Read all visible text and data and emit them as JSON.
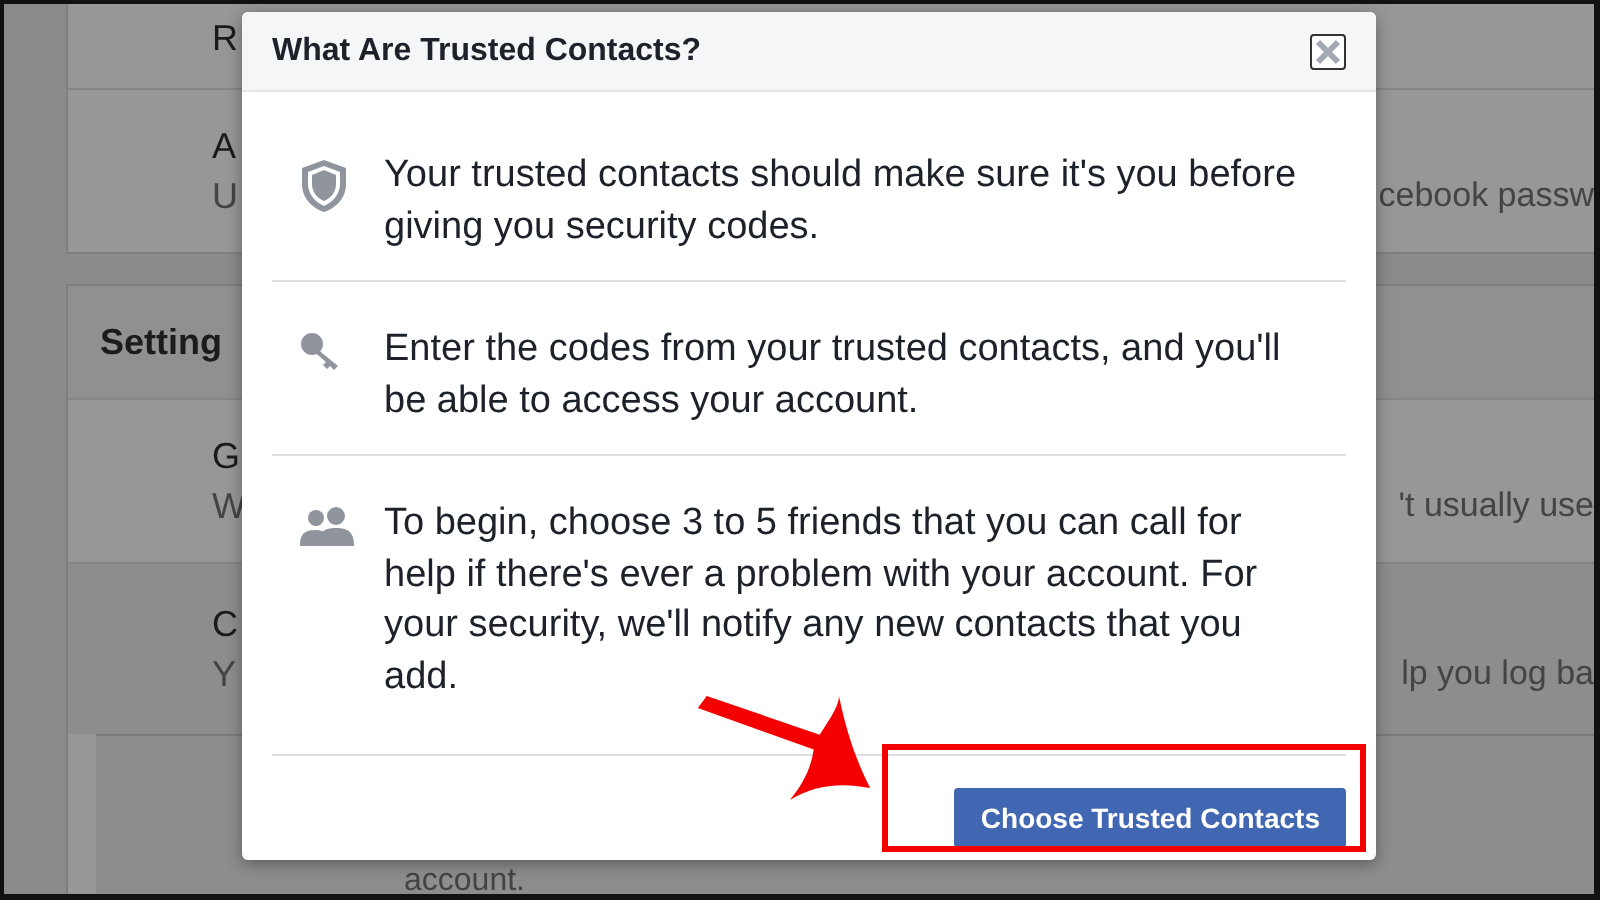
{
  "background": {
    "panels": [
      {
        "rows": [
          {
            "kind": "row",
            "left": [
              "R"
            ],
            "right": ""
          },
          {
            "kind": "row",
            "left": [
              "A",
              "U"
            ],
            "right": "cebook passw"
          }
        ]
      },
      {
        "rows": [
          {
            "kind": "header",
            "left": [
              "Setting"
            ],
            "right": ""
          },
          {
            "kind": "row",
            "left": [
              "G",
              "W"
            ],
            "right": "'t usually use"
          },
          {
            "kind": "expanded",
            "left": [
              "C",
              "Y"
            ],
            "right": "lp you log ba",
            "note": "account."
          }
        ]
      }
    ]
  },
  "dialog": {
    "title": "What Are Trusted Contacts?",
    "items": [
      {
        "kind": "shield",
        "text": "Your trusted contacts should make sure it's you before giving you security codes."
      },
      {
        "kind": "key",
        "text": "Enter the codes from your trusted contacts, and you'll be able to access your account."
      },
      {
        "kind": "people",
        "text": "To begin, choose 3 to 5 friends that you can call for help if there's ever a problem with your account. For your security, we'll notify any new contacts that you add."
      }
    ],
    "button": "Choose Trusted Contacts"
  }
}
